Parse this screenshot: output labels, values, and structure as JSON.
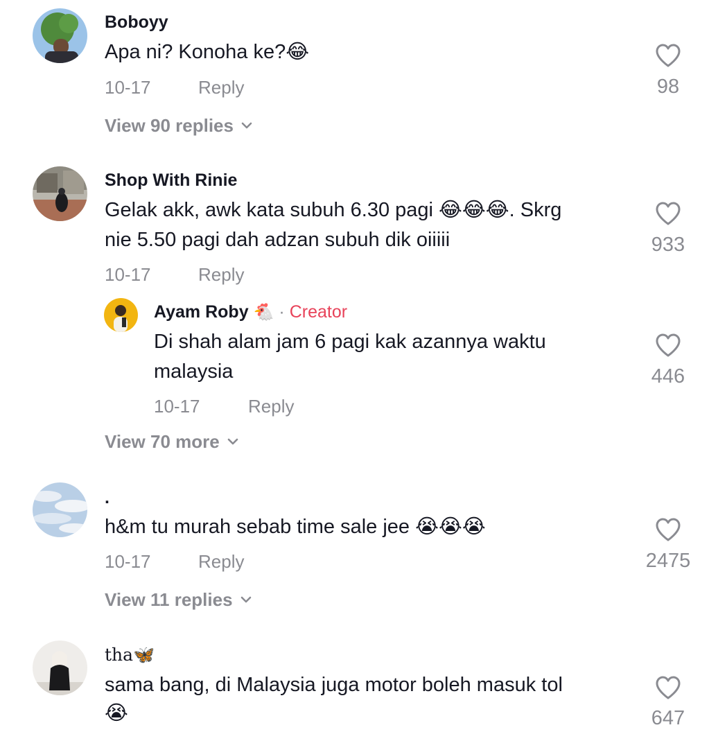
{
  "comments": [
    {
      "username": "Boboyy",
      "text": "Apa ni? Konoha ke?😂",
      "date": "10-17",
      "reply_label": "Reply",
      "likes": "98",
      "view_replies": "View 90 replies"
    },
    {
      "username": "Shop With Rinie",
      "text_line1": "Gelak akk, awk kata subuh 6.30 pagi 😂😂😂. Skrg",
      "text_line2": "nie 5.50 pagi dah adzan subuh dik oiiiii",
      "date": "10-17",
      "reply_label": "Reply",
      "likes": "933",
      "reply": {
        "username": "Ayam Roby",
        "username_emoji": "🐔",
        "separator": "·",
        "badge": "Creator",
        "text_line1": "Di shah alam jam 6 pagi kak azannya waktu",
        "text_line2": "malaysia",
        "date": "10-17",
        "reply_label": "Reply",
        "likes": "446"
      },
      "view_more": "View 70 more"
    },
    {
      "username": ".",
      "text": "h&m tu murah sebab time sale jee 😭😭😭",
      "date": "10-17",
      "reply_label": "Reply",
      "likes": "2475",
      "view_replies": "View 11 replies"
    },
    {
      "username": "tha🦋",
      "text_line1": "sama bang, di Malaysia juga motor boleh masuk tol",
      "text_line2": "😭",
      "likes": "647"
    }
  ],
  "icons": {
    "like": "heart-outline-icon",
    "expand": "chevron-down-icon"
  },
  "colors": {
    "text": "#161823",
    "secondary": "#8a8b91",
    "creator": "#e8435a"
  }
}
